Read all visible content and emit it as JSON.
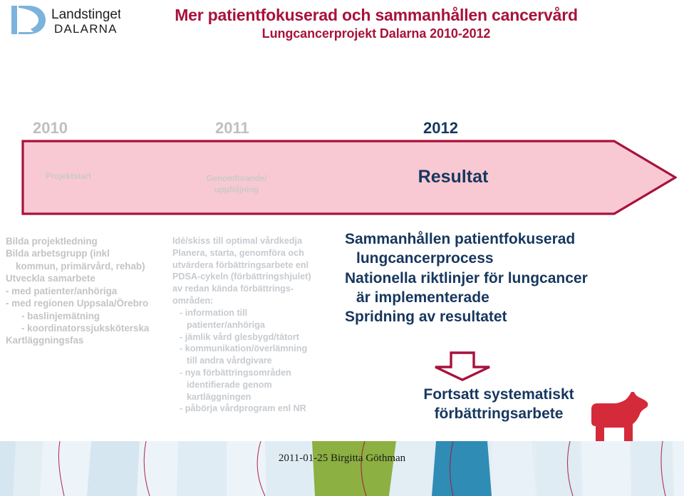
{
  "header": {
    "logo_name": "Landstinget Dalarna",
    "logo_line1": "Landstinget",
    "logo_line2": "DALARNA",
    "title_main": "Mer patientfokuserad och sammanhållen cancervård",
    "title_sub": "Lungcancerprojekt Dalarna 2010-2012",
    "title_color": "#a8123c"
  },
  "timeline": {
    "years": [
      {
        "label": "2010",
        "color": "#bfbfbf"
      },
      {
        "label": "2011",
        "color": "#bfbfbf"
      },
      {
        "label": "2012",
        "color": "#17375e"
      }
    ],
    "arrow_fill": "#f9c9d3",
    "arrow_stroke": "#a8123c",
    "phases": [
      {
        "label": "Projektstart",
        "color": "#c9c9c9"
      },
      {
        "label": "Genomförande/\nuppföljning",
        "line1": "Genomförande/",
        "line2": "uppföljning",
        "color": "#c9c9c9"
      },
      {
        "label": "Resultat",
        "color": "#17375e"
      }
    ]
  },
  "columns": {
    "left": {
      "name": "phase-2010-details",
      "color": "#c4c4c4",
      "lines": [
        "Bilda projektledning",
        "Bilda arbetsgrupp (inkl",
        "kommun, primärvård, rehab)",
        "Utveckla samarbete",
        "- med patienter/anhöriga",
        "- med regionen Uppsala/Örebro",
        "- baslinjemätning",
        "- koordinatorssjuksköterska",
        "Kartläggningsfas"
      ]
    },
    "middle": {
      "name": "phase-2011-details",
      "color": "#c7cbd0",
      "lines": [
        "Idé/skiss till optimal vårdkedja",
        "Planera, starta, genomföra och",
        "utvärdera förbättringsarbete enl",
        "PDSA-cykeln (förbättringshjulet)",
        "av redan kända förbättrings-",
        "områden:",
        "- information till",
        "patienter/anhöriga",
        "- jämlik vård glesbygd/tätort",
        "- kommunikation/överlämning",
        "till andra vårdgivare",
        "- nya förbättringsområden",
        "identifierade genom",
        "kartläggningen",
        "- påbörja vårdprogram enl NR"
      ]
    },
    "right": {
      "name": "phase-2012-results",
      "color": "#17375e",
      "lines": [
        "Sammanhållen patientfokuserad",
        "lungcancerprocess",
        "Nationella riktlinjer för lungcancer",
        "är implementerade",
        "Spridning av resultatet"
      ]
    }
  },
  "closing": {
    "arrow_color": "#a8123c",
    "lines": [
      "Fortsatt systematiskt",
      "förbättringsarbete"
    ],
    "color": "#17375e"
  },
  "decor": {
    "dala_horse_color": "#d42a3a",
    "footer_band_light": "#e2edf4",
    "footer_band_pale": "#d3e3ee",
    "footer_band_green": "#8cb041",
    "footer_band_blue": "#2f8cb5",
    "footer_line_red": "#a8123c"
  },
  "footer": {
    "text": "2011-01-25 Birgitta Göthman"
  }
}
